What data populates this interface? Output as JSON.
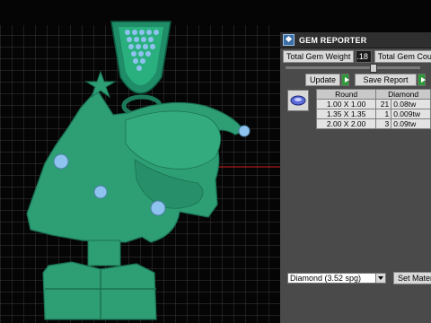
{
  "panel": {
    "title": "GEM REPORTER",
    "total_weight_label": "Total Gem Weight",
    "total_weight_value": ".18",
    "total_count_label": "Total Gem Cou",
    "update_label": "Update",
    "save_report_label": "Save Report",
    "table": {
      "headers": [
        "Round",
        "Diamond"
      ],
      "rows": [
        {
          "size": "1.00 X 1.00",
          "count": "21",
          "weight": "0.08tw"
        },
        {
          "size": "1.35 X 1.35",
          "count": "1",
          "weight": "0.009tw"
        },
        {
          "size": "2.00 X 2.00",
          "count": "3",
          "weight": "0.09tw"
        }
      ]
    },
    "material_select_value": "Diamond      (3.52 spg)",
    "set_material_label": "Set Mater"
  },
  "colors": {
    "model_green": "#2e9e74",
    "grid_line": "#5a5a5a",
    "axis_red": "#d02020",
    "gem_blue": "#8fc3ef"
  },
  "icons": {
    "app_icon": "gem-reporter-icon",
    "play_icon": "play-icon",
    "gem_preview": "round-gem-icon",
    "dropdown": "chevron-down-icon"
  }
}
